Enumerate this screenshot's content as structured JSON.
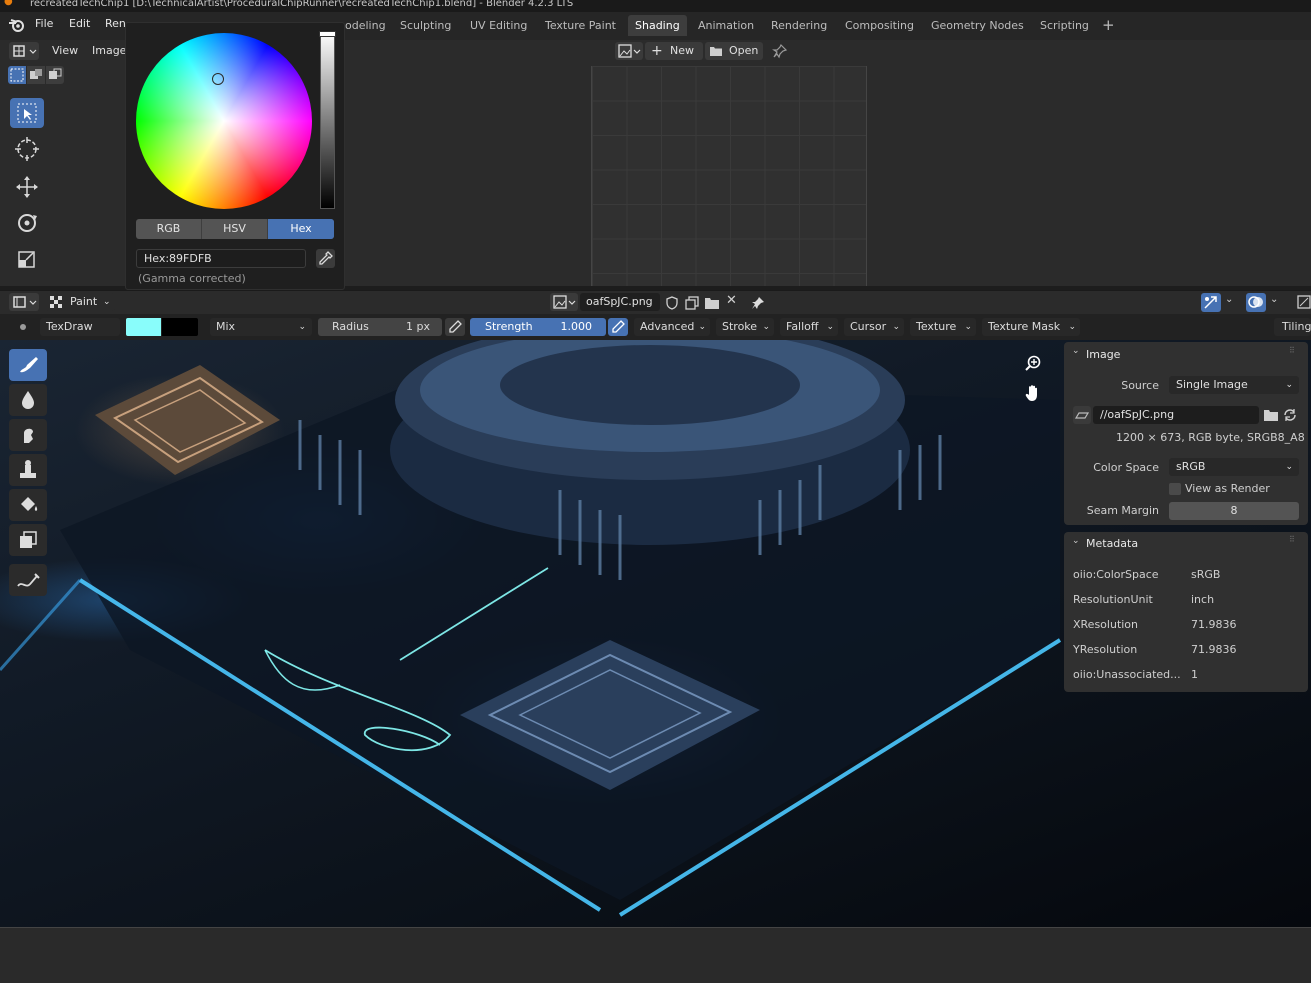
{
  "title_bar": {
    "text": "recreatedTechChip1 [D:\\TechnicalArtist\\ProceduralChipRunner\\recreatedTechChip1.blend] - Blender 4.2.3 LTS"
  },
  "menu": {
    "file": "File",
    "edit": "Edit",
    "render": "Ren"
  },
  "workspaces": [
    {
      "label": "odeling"
    },
    {
      "label": "Sculpting"
    },
    {
      "label": "UV Editing"
    },
    {
      "label": "Texture Paint"
    },
    {
      "label": "Shading"
    },
    {
      "label": "Animation"
    },
    {
      "label": "Rendering"
    },
    {
      "label": "Compositing"
    },
    {
      "label": "Geometry Nodes"
    },
    {
      "label": "Scripting"
    }
  ],
  "active_workspace": "Shading",
  "upper_editor": {
    "view_menu": "View",
    "image_menu": "Image",
    "new_label": "New",
    "open_label": "Open"
  },
  "color_picker": {
    "modes": [
      "RGB",
      "HSV",
      "Hex"
    ],
    "active_mode": "Hex",
    "hex_value": "Hex:89FDFB",
    "note": "(Gamma corrected)",
    "color": "#89FDFB"
  },
  "lower_header": {
    "mode": "Paint",
    "image_name": "oafSpJC.png"
  },
  "tool_settings": {
    "brush": "TexDraw",
    "primary_color": "#89FDFB",
    "secondary_color": "#000000",
    "blend": "Mix",
    "radius_label": "Radius",
    "radius_value": "1 px",
    "strength_label": "Strength",
    "strength_value": "1.000",
    "menus": [
      "Advanced",
      "Stroke",
      "Falloff",
      "Cursor",
      "Texture",
      "Texture Mask"
    ],
    "tiling": "Tiling"
  },
  "image_panel": {
    "title": "Image",
    "source_label": "Source",
    "source_value": "Single Image",
    "filepath": "//oafSpJC.png",
    "info": "1200 × 673,  RGB byte, SRGB8_A8",
    "colorspace_label": "Color Space",
    "colorspace_value": "sRGB",
    "view_as_render": "View as Render",
    "seam_margin_label": "Seam Margin",
    "seam_margin_value": "8"
  },
  "metadata_panel": {
    "title": "Metadata",
    "rows": [
      {
        "key": "oiio:ColorSpace",
        "value": "sRGB"
      },
      {
        "key": "ResolutionUnit",
        "value": "inch"
      },
      {
        "key": "XResolution",
        "value": "71.9836"
      },
      {
        "key": "YResolution",
        "value": "71.9836"
      },
      {
        "key": "oiio:Unassociated...",
        "value": "1"
      }
    ]
  },
  "colors": {
    "accent": "#4772b3",
    "header": "#2b2b2b",
    "panel": "#303030"
  }
}
